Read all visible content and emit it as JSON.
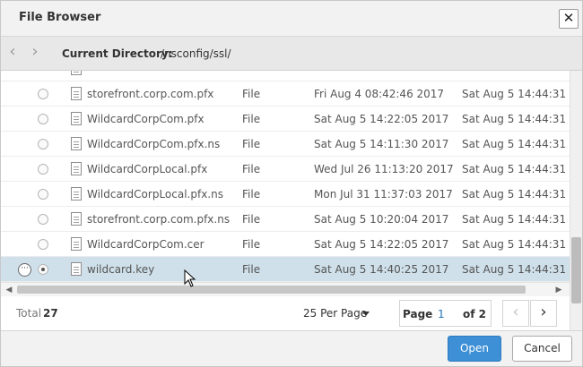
{
  "dialog": {
    "title": "File Browser",
    "close_glyph": "✕"
  },
  "pathbar": {
    "back_glyph": "‹",
    "forward_glyph": "›",
    "current_directory_label": "Current Directory:",
    "current_directory": "/nsconfig/ssl/"
  },
  "files": [
    {
      "name": "storefront.corp.com.pfx",
      "type": "File",
      "modified": "Fri Aug  4 08:42:46 2017",
      "created": "Sat Aug  5 14:44:31 2017",
      "selected": false
    },
    {
      "name": "WildcardCorpCom.pfx",
      "type": "File",
      "modified": "Sat Aug  5 14:22:05 2017",
      "created": "Sat Aug  5 14:44:31 2017",
      "selected": false
    },
    {
      "name": "WildcardCorpCom.pfx.ns",
      "type": "File",
      "modified": "Sat Aug  5 14:11:30 2017",
      "created": "Sat Aug  5 14:44:31 2017",
      "selected": false
    },
    {
      "name": "WildcardCorpLocal.pfx",
      "type": "File",
      "modified": "Wed Jul 26 11:13:20 2017",
      "created": "Sat Aug  5 14:44:31 2017",
      "selected": false
    },
    {
      "name": "WildcardCorpLocal.pfx.ns",
      "type": "File",
      "modified": "Mon Jul 31 11:37:03 2017",
      "created": "Sat Aug  5 14:44:31 2017",
      "selected": false
    },
    {
      "name": "storefront.corp.com.pfx.ns",
      "type": "File",
      "modified": "Sat Aug  5 10:20:04 2017",
      "created": "Sat Aug  5 14:44:31 2017",
      "selected": false
    },
    {
      "name": "WildcardCorpCom.cer",
      "type": "File",
      "modified": "Sat Aug  5 14:22:05 2017",
      "created": "Sat Aug  5 14:44:31 2017",
      "selected": false
    },
    {
      "name": "wildcard.key",
      "type": "File",
      "modified": "Sat Aug  5 14:40:25 2017",
      "created": "Sat Aug  5 14:44:31 2017",
      "selected": true
    }
  ],
  "row_actions_glyph": "···",
  "footer": {
    "total_label": "Total",
    "total_value": "27",
    "per_page_label": "25 Per Page",
    "page_label": "Page",
    "page_number": "1",
    "page_of": "of 2",
    "prev_glyph": "‹",
    "next_glyph": "›"
  },
  "buttons": {
    "open": "Open",
    "cancel": "Cancel"
  },
  "colors": {
    "selected_row": "#cfe0ea",
    "primary": "#3d8fd6",
    "link": "#1f72b8"
  }
}
